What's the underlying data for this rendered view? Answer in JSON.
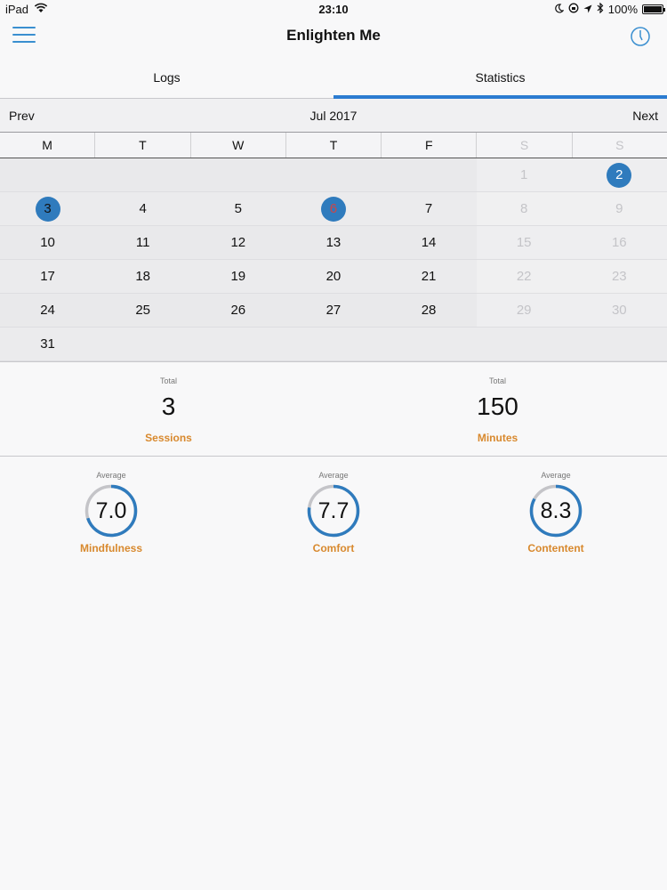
{
  "status_bar": {
    "device": "iPad",
    "time": "23:10",
    "battery": "100%",
    "battery_level": 1.0
  },
  "nav": {
    "title": "Enlighten Me"
  },
  "tabs": [
    {
      "label": "Logs",
      "active": false
    },
    {
      "label": "Statistics",
      "active": true
    }
  ],
  "calendar": {
    "prev_label": "Prev",
    "next_label": "Next",
    "month_label": "Jul 2017",
    "weekdays": [
      "M",
      "T",
      "W",
      "T",
      "F",
      "S",
      "S"
    ],
    "weeks": [
      [
        "",
        "",
        "",
        "",
        "",
        "1",
        "2"
      ],
      [
        "3",
        "4",
        "5",
        "6",
        "7",
        "8",
        "9"
      ],
      [
        "10",
        "11",
        "12",
        "13",
        "14",
        "15",
        "16"
      ],
      [
        "17",
        "18",
        "19",
        "20",
        "21",
        "22",
        "23"
      ],
      [
        "24",
        "25",
        "26",
        "27",
        "28",
        "29",
        "30"
      ],
      [
        "31",
        "",
        "",
        "",
        "",
        "",
        ""
      ]
    ],
    "session_days": [
      "2",
      "3",
      "6"
    ],
    "today": "6",
    "accent_color": "#2f7bbd",
    "today_color": "#d04545"
  },
  "totals": {
    "sessions": {
      "caption": "Total",
      "value": "3",
      "label": "Sessions"
    },
    "minutes": {
      "caption": "Total",
      "value": "150",
      "label": "Minutes"
    }
  },
  "averages": [
    {
      "caption": "Average",
      "value": "7.0",
      "score": 7.0,
      "label": "Mindfulness"
    },
    {
      "caption": "Average",
      "value": "7.7",
      "score": 7.7,
      "label": "Comfort"
    },
    {
      "caption": "Average",
      "value": "8.3",
      "score": 8.3,
      "label": "Contentent"
    }
  ],
  "colors": {
    "accent": "#2c7cd1",
    "gauge_fill": "#2f7bbd",
    "gauge_track": "#c4c4c8",
    "label_orange": "#d8892e"
  }
}
